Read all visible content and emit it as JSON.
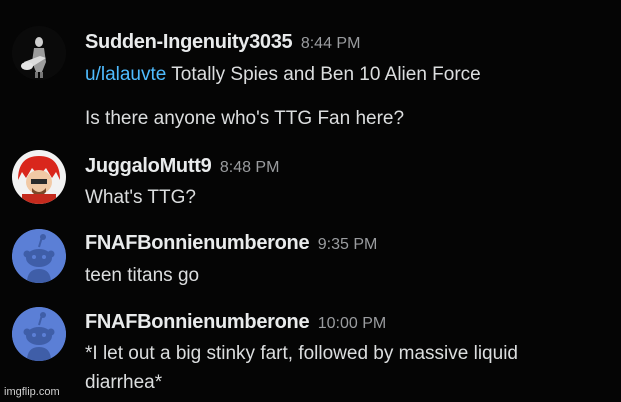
{
  "messages": [
    {
      "username": "Sudden-Ingenuity3035",
      "time": "8:44 PM",
      "avatar_icon": "guitarist-silhouette-avatar",
      "lines": [
        {
          "mention": "u/lalauvte",
          "text": " Totally Spies and Ben 10 Alien Force"
        },
        {
          "text": "Is there anyone who's TTG Fan here?"
        }
      ]
    },
    {
      "username": "JuggaloMutt9",
      "time": "8:48 PM",
      "avatar_icon": "red-haired-cartoon-avatar",
      "lines": [
        {
          "text": "What's TTG?"
        }
      ]
    },
    {
      "username": "FNAFBonnienumberone",
      "time": "9:35 PM",
      "avatar_icon": "reddit-snoo-default-avatar",
      "lines": [
        {
          "text": "teen titans go"
        }
      ]
    },
    {
      "username": "FNAFBonnienumberone",
      "time": "10:00 PM",
      "avatar_icon": "reddit-snoo-default-avatar",
      "lines": [
        {
          "text": "*I let out a big stinky fart, followed by massive liquid"
        },
        {
          "text": "diarrhea*"
        }
      ]
    }
  ],
  "watermark": "imgflip.com",
  "colors": {
    "background": "#050505",
    "username": "#e9ebec",
    "timestamp": "#9a9c9f",
    "text": "#dcdedf",
    "mention": "#4fbcff",
    "snoo_avatar_bg": "#5b7fd6"
  }
}
